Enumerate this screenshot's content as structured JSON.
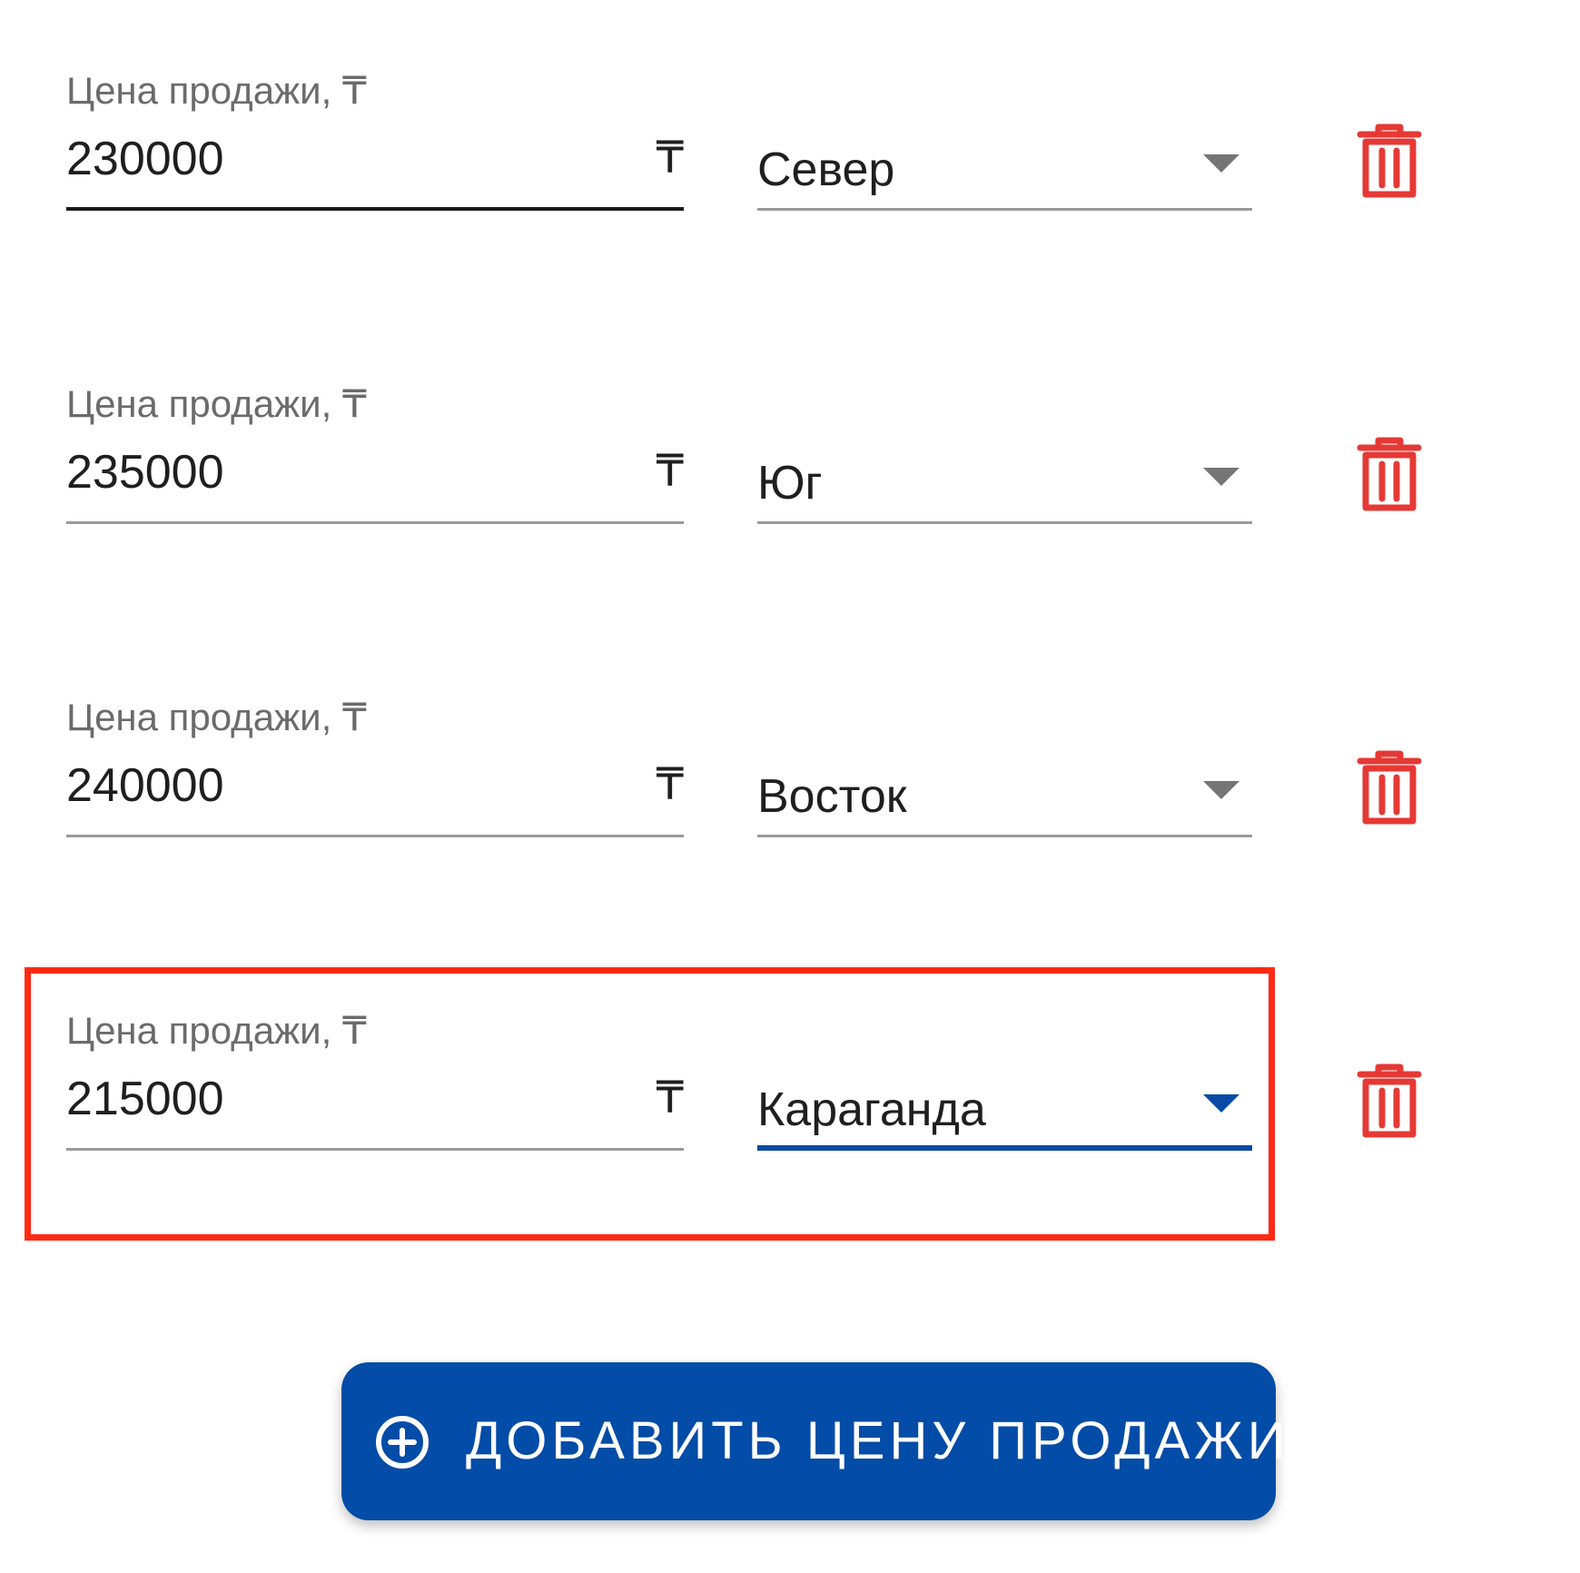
{
  "price_label": "Цена продажи, ₸",
  "currency_symbol": "₸",
  "rows": [
    {
      "price": "230000",
      "region": "Север",
      "focused": false
    },
    {
      "price": "235000",
      "region": "Юг",
      "focused": false
    },
    {
      "price": "240000",
      "region": "Восток",
      "focused": false
    },
    {
      "price": "215000",
      "region": "Караганда",
      "focused": true
    }
  ],
  "add_button": {
    "label": "ДОБАВИТЬ ЦЕНУ ПРОДАЖИ",
    "icon": "add-circle-icon"
  },
  "colors": {
    "accent": "#034ca7",
    "delete": "#e53935",
    "highlight": "#ff2a14",
    "label": "#6b6b6b"
  }
}
